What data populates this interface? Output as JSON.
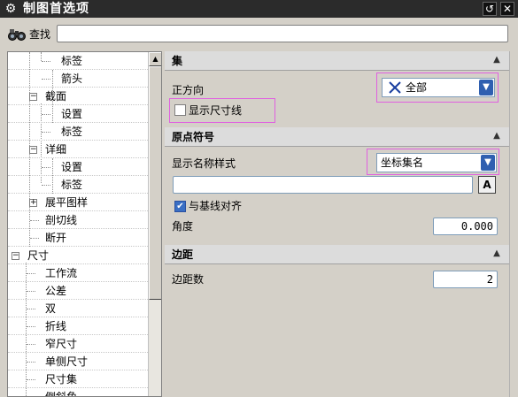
{
  "window": {
    "title": "制图首选项",
    "gear_icon": "gear-icon",
    "reset_icon": "↺",
    "close_icon": "✕"
  },
  "search": {
    "label": "查找",
    "value": "",
    "placeholder": ""
  },
  "tree": {
    "items": [
      {
        "label": "标签",
        "level": 2,
        "expander": ""
      },
      {
        "label": "箭头",
        "level": 2,
        "expander": ""
      },
      {
        "label": "截面",
        "level": 1,
        "expander": "−"
      },
      {
        "label": "设置",
        "level": 2,
        "expander": ""
      },
      {
        "label": "标签",
        "level": 2,
        "expander": ""
      },
      {
        "label": "详细",
        "level": 1,
        "expander": "−"
      },
      {
        "label": "设置",
        "level": 2,
        "expander": ""
      },
      {
        "label": "标签",
        "level": 2,
        "expander": ""
      },
      {
        "label": "展平图样",
        "level": 1,
        "expander": "+"
      },
      {
        "label": "剖切线",
        "level": 1,
        "expander": ""
      },
      {
        "label": "断开",
        "level": 1,
        "expander": ""
      },
      {
        "label": "尺寸",
        "level": 0,
        "expander": "−"
      },
      {
        "label": "工作流",
        "level": 1,
        "expander": ""
      },
      {
        "label": "公差",
        "level": 1,
        "expander": ""
      },
      {
        "label": "双",
        "level": 1,
        "expander": ""
      },
      {
        "label": "折线",
        "level": 1,
        "expander": ""
      },
      {
        "label": "窄尺寸",
        "level": 1,
        "expander": ""
      },
      {
        "label": "单侧尺寸",
        "level": 1,
        "expander": ""
      },
      {
        "label": "尺寸集",
        "level": 1,
        "expander": ""
      },
      {
        "label": "倒斜角",
        "level": 1,
        "expander": ""
      }
    ]
  },
  "sections": {
    "set": {
      "title": "集",
      "orientation_label": "正方向",
      "orientation_value": "全部",
      "show_dimension_lines_label": "显示尺寸线",
      "show_dimension_lines_checked": false
    },
    "origin_symbol": {
      "title": "原点符号",
      "display_name_style_label": "显示名称样式",
      "display_name_style_value": "坐标集名",
      "name_text_value": "",
      "font_button_label": "A",
      "align_with_baseline_label": "与基线对齐",
      "align_with_baseline_checked": true,
      "angle_label": "角度",
      "angle_value": "0.000"
    },
    "margin": {
      "title": "边距",
      "margin_count_label": "边距数",
      "margin_count_value": "2"
    }
  },
  "icons": {
    "collapse": "▲",
    "dropdown": "▼",
    "check": "✔",
    "scroll_up": "▲"
  },
  "colors": {
    "titlebar": "#2b2b2b",
    "highlight": "#e060e0",
    "dropdown_arrow": "#2f5fb0"
  }
}
